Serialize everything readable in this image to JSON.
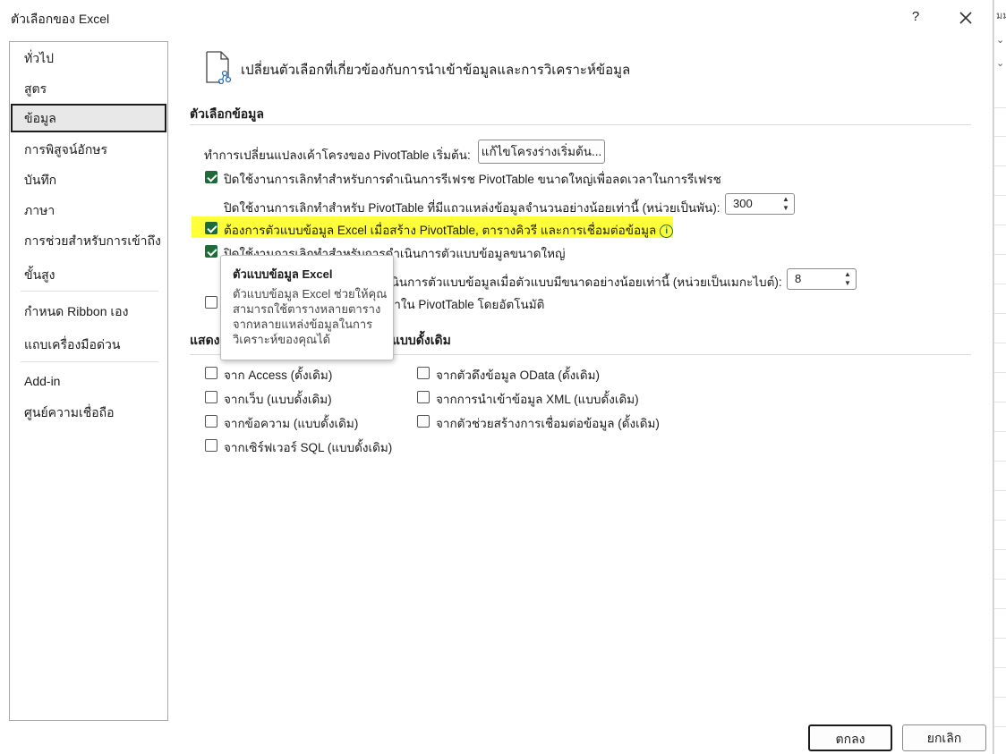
{
  "window": {
    "title": "ตัวเลือกของ Excel",
    "help": "?"
  },
  "sidebar": {
    "items": [
      {
        "label": "ทั่วไป"
      },
      {
        "label": "สูตร"
      },
      {
        "label": "ข้อมูล",
        "selected": true
      },
      {
        "label": "การพิสูจน์อักษร"
      },
      {
        "label": "บันทึก"
      },
      {
        "label": "ภาษา"
      },
      {
        "label": "การช่วยสำหรับการเข้าถึง"
      },
      {
        "label": "ขั้นสูง"
      },
      {
        "label": "กำหนด Ribbon เอง"
      },
      {
        "label": "แถบเครื่องมือด่วน"
      },
      {
        "label": "Add-in"
      },
      {
        "label": "ศูนย์ความเชื่อถือ"
      }
    ]
  },
  "header": {
    "text": "เปลี่ยนตัวเลือกที่เกี่ยวข้องกับการนำเข้าข้อมูลและการวิเคราะห์ข้อมูล",
    "icon": "document-data-icon"
  },
  "data_options": {
    "title": "ตัวเลือกข้อมูล",
    "pivot_layout_label": "ทำการเปลี่ยนแปลงเค้าโครงของ PivotTable เริ่มต้น:",
    "pivot_layout_button": "แก้ไขโครงร่างเริ่มต้น...",
    "undo_refresh_label": "ปิดใช้งานการเลิกทำสำหรับการดำเนินการรีเฟรช PivotTable ขนาดใหญ่เพื่อลดเวลาในการรีเฟรช",
    "undo_refresh_checked": true,
    "undo_rows_label": "ปิดใช้งานการเลิกทำสำหรับ PivotTable ที่มีแถวแหล่งข้อมูลจำนวนอย่างน้อยเท่านี้ (หน่วยเป็นพัน):",
    "undo_rows_value": "300",
    "prefer_model_label": "ต้องการตัวแบบข้อมูล Excel เมื่อสร้าง PivotTable, ตารางคิวรี และการเชื่อมต่อข้อมูล",
    "prefer_model_checked": true,
    "undo_model_label": "ปิดใช้งานการเลิกทำสำหรับการดำเนินการตัวแบบข้อมูลขนาดใหญ่",
    "undo_model_checked": true,
    "undo_model_size_label": "เนินการตัวแบบข้อมูลเมื่อตัวแบบมีขนาดอย่างน้อยเท่านี้ (หน่วยเป็นเมกะไบต์):",
    "undo_model_size_value": "8",
    "auto_group_label": "ลาใน PivotTable โดยอัตโนมัติ",
    "auto_group_checked": false
  },
  "legacy": {
    "title_left": "แสดง",
    "title_right": "แบบดั้งเดิม",
    "items_left": [
      {
        "label": "จาก Access (ดั้งเดิม)",
        "checked": false
      },
      {
        "label": "จากเว็บ (แบบดั้งเดิม)",
        "checked": false
      },
      {
        "label": "จากข้อความ (แบบดั้งเดิม)",
        "checked": false
      },
      {
        "label": "จากเซิร์ฟเวอร์ SQL (แบบดั้งเดิม)",
        "checked": false
      }
    ],
    "items_right": [
      {
        "label": "จากตัวดึงข้อมูล OData (ดั้งเดิม)",
        "checked": false
      },
      {
        "label": "จากการนำเข้าข้อมูล XML (แบบดั้งเดิม)",
        "checked": false
      },
      {
        "label": "จากตัวช่วยสร้างการเชื่อมต่อข้อมูล (ดั้งเดิม)",
        "checked": false
      }
    ]
  },
  "tooltip": {
    "title": "ตัวแบบข้อมูล Excel",
    "body": "ตัวแบบข้อมูล Excel ช่วยให้คุณสามารถใช้ตารางหลายตารางจากหลายแหล่งข้อมูลในการวิเคราะห์ของคุณได้"
  },
  "footer": {
    "ok": "ตกลง",
    "cancel": "ยกเลิก"
  },
  "colors": {
    "accent": "#1e6b3a",
    "highlight": "#ffff3a"
  }
}
